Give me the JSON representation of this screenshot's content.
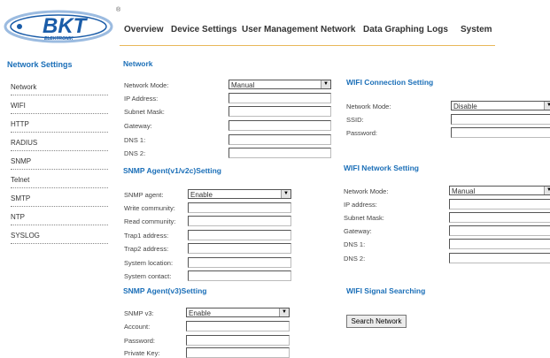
{
  "logo": {
    "text": "BKT",
    "subtext": "ELEKTRONIK",
    "mark": "®"
  },
  "nav": [
    "Overview",
    "Device Settings",
    "User Management",
    "Network",
    "Data Graphing",
    "Logs",
    "System"
  ],
  "sidebar": {
    "title": "Network Settings",
    "items": [
      "Network",
      "WIFI",
      "HTTP",
      "RADIUS",
      "SNMP",
      "Telnet",
      "SMTP",
      "NTP",
      "SYSLOG"
    ]
  },
  "network": {
    "title": "Network",
    "mode_label": "Network Mode:",
    "mode_value": "Manual",
    "labels": [
      "IP Address:",
      "Subnet Mask:",
      "Gateway:",
      "DNS 1:",
      "DNS 2:"
    ]
  },
  "snmp12": {
    "title": "SNMP Agent(v1/v2c)Setting",
    "agent_label": "SNMP agent:",
    "agent_value": "Enable",
    "labels": [
      "Write community:",
      "Read community:",
      "Trap1 address:",
      "Trap2 address:",
      "System location:",
      "System contact:"
    ]
  },
  "snmp3": {
    "title": "SNMP Agent(v3)Setting",
    "v3_label": "SNMP v3:",
    "v3_value": "Enable",
    "labels": [
      "Account:",
      "Password:",
      "Private Key:"
    ]
  },
  "wifi_conn": {
    "title": "WIFI Connection Setting",
    "mode_label": "Network Mode:",
    "mode_value": "Disable",
    "labels": [
      "SSID:",
      "Password:"
    ]
  },
  "wifi_net": {
    "title": "WIFI Network Setting",
    "mode_label": "Network Mode:",
    "mode_value": "Manual",
    "labels": [
      "IP address:",
      "Subnet Mask:",
      "Gateway:",
      "DNS 1:",
      "DNS 2:"
    ]
  },
  "wifi_search": {
    "title": "WIFI Signal Searching",
    "button": "Search Network"
  },
  "colors": {
    "accent": "#1b6fb8",
    "logo_blue": "#1a5ca8",
    "nav_rule": "#e8b85a"
  }
}
